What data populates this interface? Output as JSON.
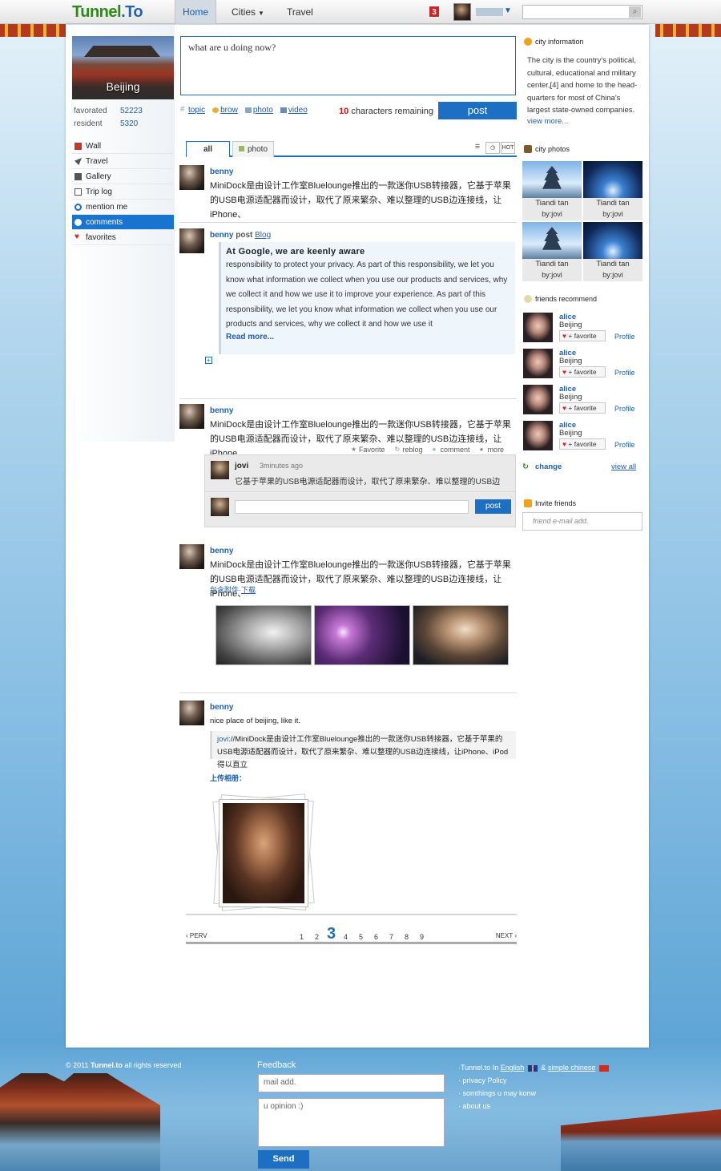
{
  "topbar": {
    "logo_main": "Tunnel",
    "logo_suffix": ".To",
    "nav": [
      {
        "label": "Home",
        "active": true
      },
      {
        "label": "Cities",
        "has_dropdown": true
      },
      {
        "label": "Travel"
      }
    ],
    "notification_count": "3",
    "search": {
      "placeholder": ""
    }
  },
  "left": {
    "city_name": "Beijing",
    "stats": [
      {
        "label": "favorated",
        "value": "52223"
      },
      {
        "label": "resident",
        "value": "5320"
      }
    ],
    "menu": [
      {
        "label": "Wall",
        "icon": "wall-icon",
        "color": "#c0392b"
      },
      {
        "label": "Travel",
        "icon": "travel-icon",
        "color": "#555555"
      },
      {
        "label": "Gallery",
        "icon": "gallery-icon",
        "color": "#555555"
      },
      {
        "label": "Trip log",
        "icon": "trip-log-icon",
        "color": "#555555"
      },
      {
        "label": "mention me",
        "icon": "mention-icon",
        "color": "#1c6fc2"
      },
      {
        "label": "comments",
        "icon": "comments-icon",
        "color": "#ffffff",
        "selected": true
      },
      {
        "label": "favorites",
        "icon": "heart-icon",
        "color": "#d22222"
      }
    ]
  },
  "composer": {
    "text": "what are u doing now?",
    "tools": [
      "topic",
      "brow",
      "photo",
      "video"
    ],
    "remaining_count": "10",
    "remaining_text": "characters remaining",
    "post_label": "post"
  },
  "tabs": {
    "all": "all",
    "photo": "photo",
    "hot": "HOT"
  },
  "feed": {
    "item1": {
      "user": "benny",
      "text": "MiniDock是由设计工作室Bluelounge推出的一款迷你USB转接器，它基于苹果的USB电源适配器而设计，取代了原来繁杂、难以整理的USB边连接线，让iPhone、"
    },
    "item2": {
      "user": "benny",
      "verb": "post",
      "link": "Blog",
      "quote_title": "At Google, we are keenly aware",
      "quote_body": "responsibility to protect your privacy. As part of this responsibility, we let you know what information we collect when you use our products and services, why we collect it and how we use it to improve your experience. As part of this responsibility, we let you know what information we collect when you use our products and services, why we collect it and how we use it",
      "read_more": "Read more..."
    },
    "item3": {
      "user": "benny",
      "text": "MiniDock是由设计工作室Bluelounge推出的一款迷你USB转接器，它基于苹果的USB电源适配器而设计，取代了原来繁杂、难以整理的USB边连接线，让iPhone、",
      "actions": [
        "Favorite",
        "reblog",
        "comment",
        "more"
      ],
      "comment": {
        "user": "jovi",
        "time": "3minutes ago",
        "text": "它基于苹果的USB电源适配器而设计，取代了原来繁杂、难以整理的USB边"
      },
      "comment_post_label": "post"
    },
    "item4": {
      "user": "benny",
      "text": "MiniDock是由设计工作室Bluelounge推出的一款迷你USB转接器，它基于苹果的USB电源适配器而设计，取代了原来繁杂、难以整理的USB边连接线，让iPhone、",
      "attach_label": "包含附件·",
      "attach_link": "下载"
    },
    "item5": {
      "user": "benny",
      "text": "nice place of beijing, like it.",
      "reply_user": "jovi:",
      "reply_text": "//MiniDock是由设计工作室Bluelounge推出的一款迷你USB转接器，它基于苹果的USB电源适配器而设计，取代了原来繁杂、难以整理的USB边连接线，让iPhone、iPod得以直立",
      "upload_label": "上传相册："
    }
  },
  "pager": {
    "prev": "PERV",
    "next": "NEXT",
    "pages": [
      "1",
      "2",
      "3",
      "4",
      "5",
      "6",
      "7",
      "8",
      "9"
    ],
    "current": "3"
  },
  "right": {
    "city_info_title": "city information",
    "city_info_text": "The city is the country's political, cultural, educational and military center,[4] and home to the head-quarters for most of China's largest state-owned companies.",
    "view_more": "view more...",
    "city_photos_title": "city photos",
    "photos": [
      {
        "title": "Tiandi tan",
        "by": "by:jovi",
        "kind": "temple"
      },
      {
        "title": "Tiandi tan",
        "by": "by:jovi",
        "kind": "night"
      },
      {
        "title": "Tiandi tan",
        "by": "by:jovi",
        "kind": "temple"
      },
      {
        "title": "Tiandi tan",
        "by": "by:jovi",
        "kind": "night"
      }
    ],
    "friends_title": "friends recommend",
    "friends": [
      {
        "name": "alice",
        "city": "Beijing",
        "fav": "+ favorite",
        "profile": "Profile"
      },
      {
        "name": "alice",
        "city": "Beijing",
        "fav": "+ favorite",
        "profile": "Profile"
      },
      {
        "name": "alice",
        "city": "Beijing",
        "fav": "+ favorite",
        "profile": "Profile"
      },
      {
        "name": "alice",
        "city": "Beijing",
        "fav": "+ favorite",
        "profile": "Profile"
      }
    ],
    "change": "change",
    "view_all": "view all",
    "invite_title": "Invite friends",
    "invite_placeholder": "friend e-mail add."
  },
  "footer": {
    "copyright_pre": "© 2011",
    "copyright_brand": "Tunnel.to",
    "copyright_post": "all rights reserved",
    "feedback_title": "Feedback",
    "mail_placeholder": "mail add.",
    "opinion_placeholder": "u opinion :)",
    "send_label": "Send",
    "lang_prefix": "·Tunnel.to  In",
    "lang_en": "English",
    "lang_amp": "&",
    "lang_cn": "simple chinese",
    "links": [
      "· privacy Policy",
      "· somthings u may konw",
      "· about us"
    ]
  }
}
